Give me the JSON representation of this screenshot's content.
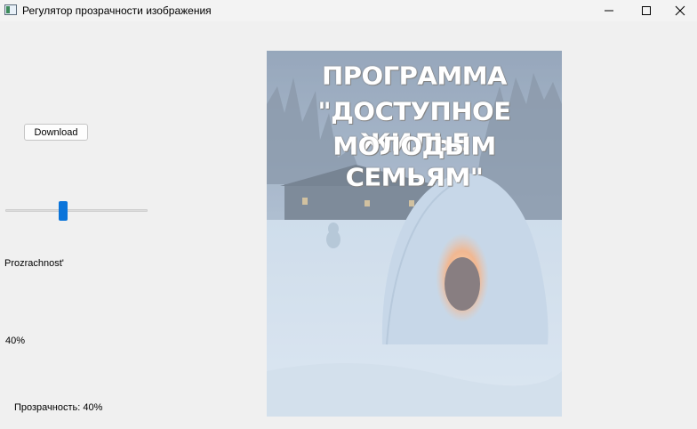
{
  "window": {
    "title": "Регулятор прозрачности изображения",
    "icon": "app-window-icon",
    "controls": [
      "minimize-icon",
      "maximize-icon",
      "close-icon"
    ]
  },
  "controls": {
    "download_label": "Download",
    "slider_value": 40,
    "slider_range": [
      0,
      100
    ],
    "opacity_caption": "Prozrachnost'",
    "percent_label": "40%",
    "status_label": "Прозрачность: 40%"
  },
  "image": {
    "opacity_percent": 40,
    "poster_lines": [
      "ПРОГРАММА",
      "\"ДОСТУПНОЕ ЖИЛЬЕ",
      "МОЛОДЫМ СЕМЬЯМ\""
    ]
  },
  "colors": {
    "accent": "#0a74da",
    "background": "#f0f0f0"
  }
}
